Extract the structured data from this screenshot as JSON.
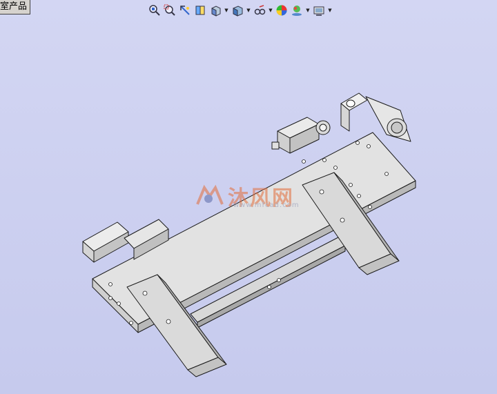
{
  "tab": {
    "label": "室产品"
  },
  "toolbar": {
    "buttons": [
      {
        "name": "zoom-to-fit-icon"
      },
      {
        "name": "zoom-to-area-icon"
      },
      {
        "name": "previous-view-icon"
      },
      {
        "name": "section-view-icon"
      },
      {
        "name": "view-orientation-icon",
        "dropdown": true
      },
      {
        "name": "display-style-icon",
        "dropdown": true
      },
      {
        "name": "hide-show-items-icon",
        "dropdown": true
      },
      {
        "name": "edit-appearance-icon"
      },
      {
        "name": "apply-scene-icon",
        "dropdown": true
      },
      {
        "name": "view-settings-icon",
        "dropdown": true
      }
    ]
  },
  "watermark": {
    "text": "沐风网",
    "sub": "www.mfcad.com",
    "logo": "MF"
  },
  "colors": {
    "background": "#c9cdef",
    "part_face": "#d4d4d4",
    "part_top": "#e4e4e4",
    "edge": "#1a1a1a"
  }
}
